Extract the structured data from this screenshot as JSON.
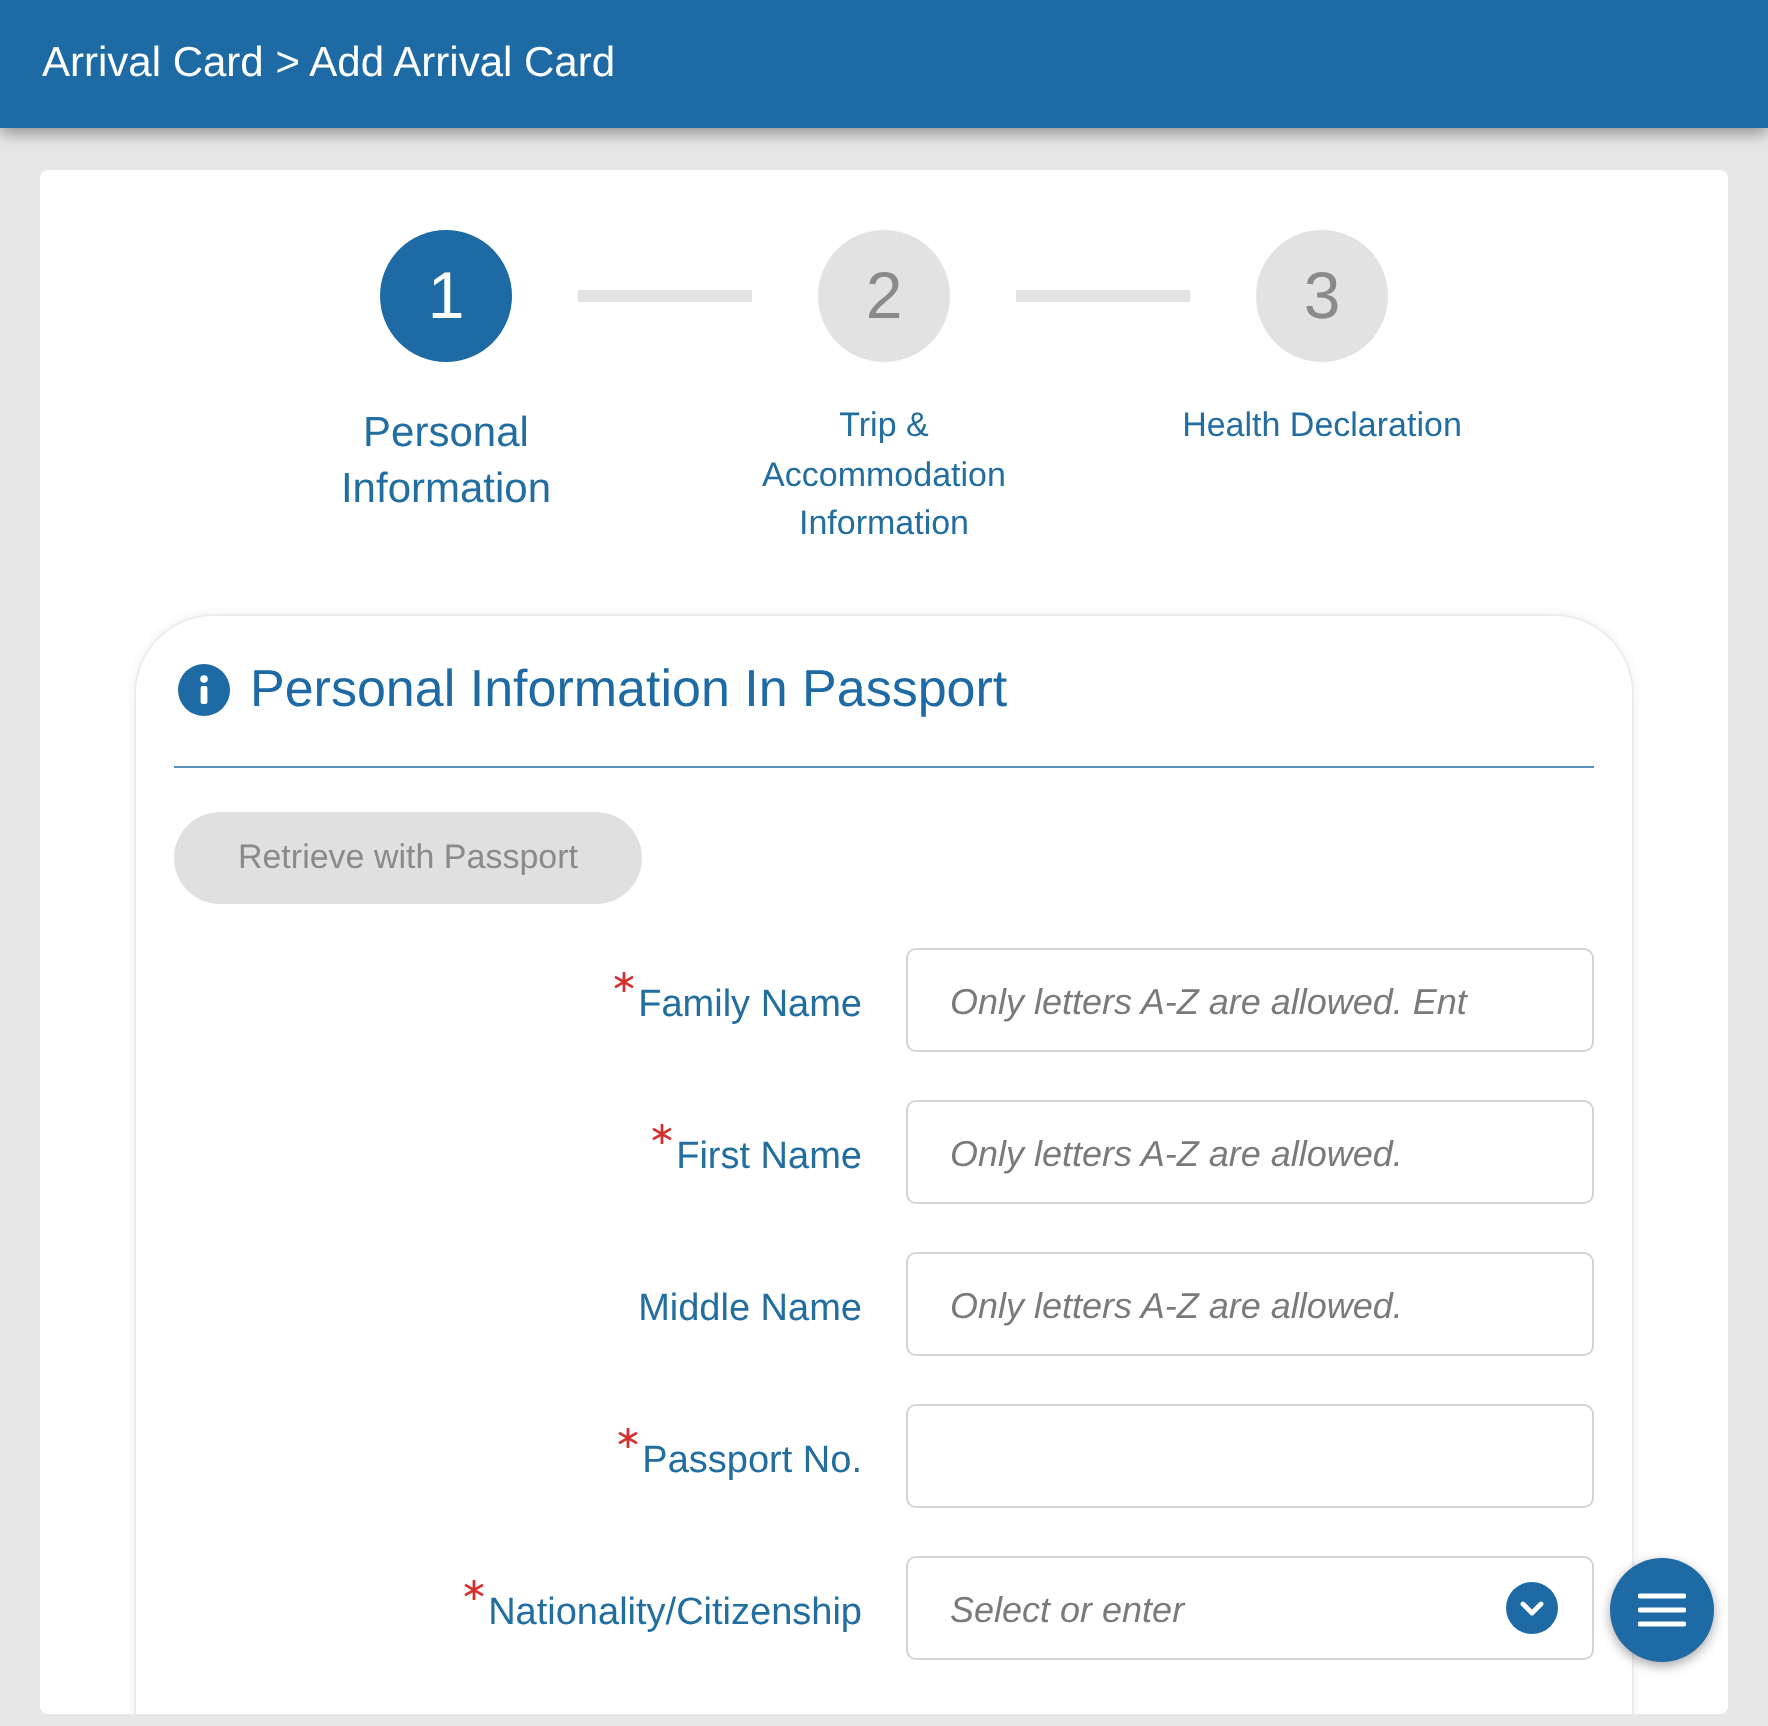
{
  "header": {
    "breadcrumb": "Arrival Card > Add Arrival Card"
  },
  "steps": [
    {
      "number": "1",
      "label": "Personal Information",
      "selected": true
    },
    {
      "number": "2",
      "label": "Trip & Accommodation Information",
      "selected": false
    },
    {
      "number": "3",
      "label": "Health Declaration",
      "selected": false
    }
  ],
  "section": {
    "title": "Personal Information In Passport",
    "retrieve_button": {
      "label": "Retrieve with Passport",
      "disabled": true
    },
    "fields": [
      {
        "kind": "text",
        "label": "Family Name",
        "required": true,
        "placeholder": "Only letters A-Z are allowed. Ent"
      },
      {
        "kind": "text",
        "label": "First Name",
        "required": true,
        "placeholder": "Only letters A-Z are allowed."
      },
      {
        "kind": "text",
        "label": "Middle Name",
        "required": false,
        "placeholder": "Only letters A-Z are allowed."
      },
      {
        "kind": "text",
        "label": "Passport No.",
        "required": true
      },
      {
        "kind": "select",
        "label": "Nationality/Citizenship",
        "required": true,
        "placeholder": "Select or enter"
      }
    ]
  }
}
